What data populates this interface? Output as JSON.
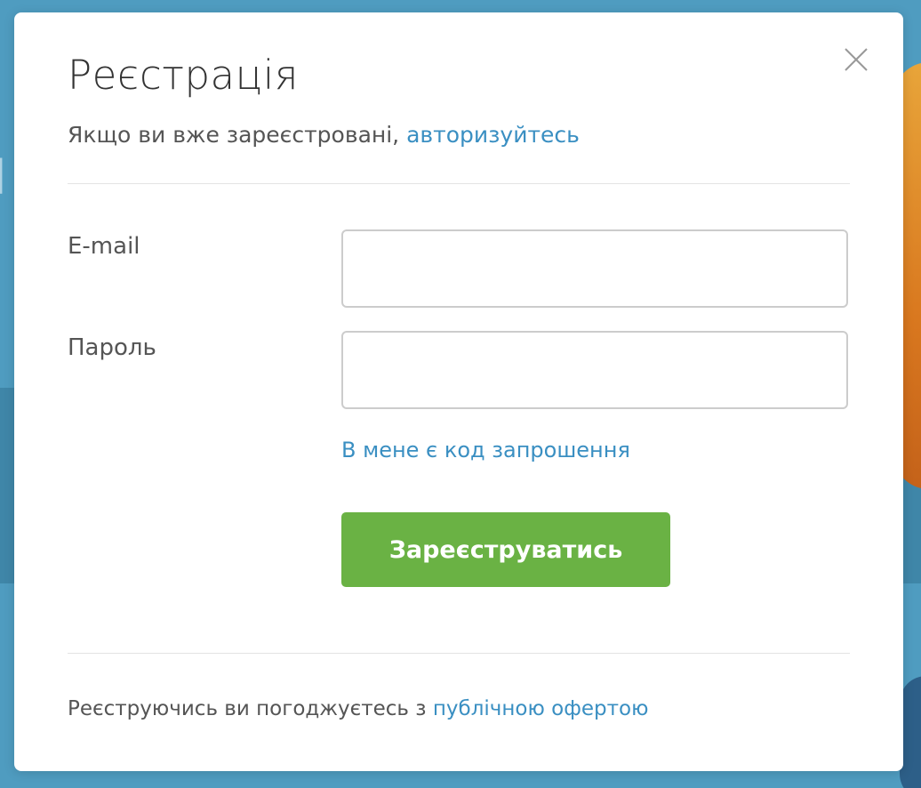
{
  "modal": {
    "title": "Реєстрація",
    "subtitle_prefix": "Якщо ви вже зареєстровані, ",
    "login_link": "авторизуйтесь",
    "close_icon": "close-icon"
  },
  "form": {
    "email_label": "E-mail",
    "email_value": "",
    "password_label": "Пароль",
    "password_value": "",
    "invite_link": "В мене є код запрошення",
    "submit_label": "Зареєструватись"
  },
  "footer": {
    "text_prefix": "Реєструючись ви погоджуєтесь з ",
    "offer_link": "публічною офертою"
  },
  "colors": {
    "accent_link": "#3a8fc2",
    "submit_button": "#6ab244",
    "backdrop": "#4f9cc0"
  }
}
